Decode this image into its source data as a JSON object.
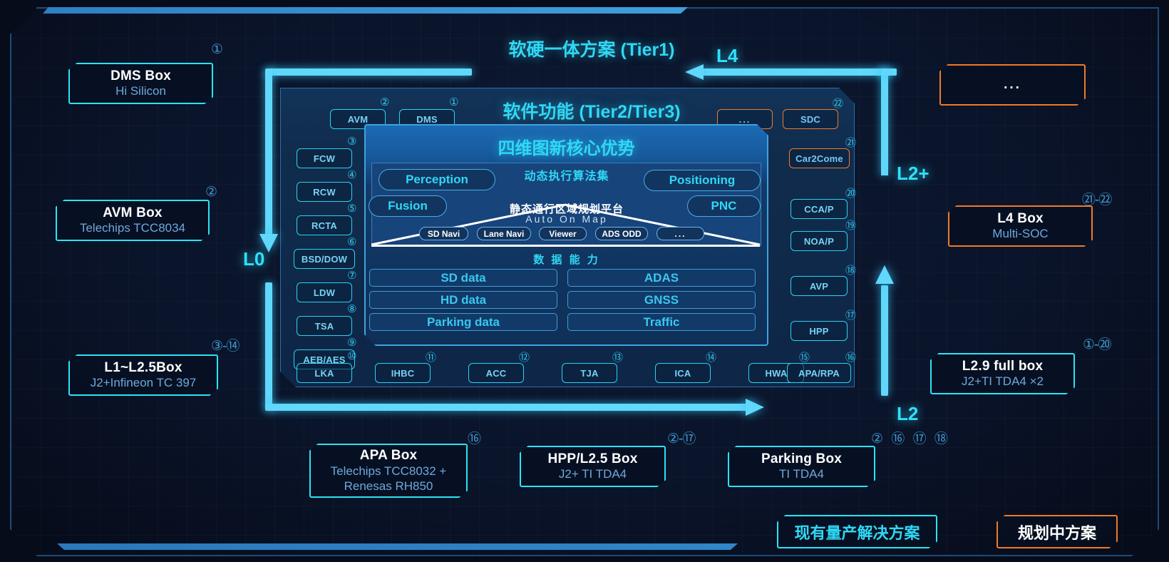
{
  "titles": {
    "tier1": "软硬一体方案 (Tier1)",
    "tier2": "软件功能 (Tier2/Tier3)",
    "core": "四维图新核心优势",
    "algo": "动态执行算法集",
    "pyramid_cn": "静态通行区域规划平台",
    "pyramid_en": "Auto On Map",
    "data_cn": "数 据 能 力"
  },
  "flow_labels": {
    "l0": "L0",
    "l2": "L2",
    "l2plus": "L2+",
    "l4": "L4"
  },
  "left_boxes": [
    {
      "title": "DMS Box",
      "sub": "Hi Silicon",
      "idx": "①"
    },
    {
      "title": "AVM Box",
      "sub": "Telechips TCC8034",
      "idx": "②"
    },
    {
      "title": "L1~L2.5Box",
      "sub": "J2+Infineon TC 397",
      "idx": "③-⑭"
    }
  ],
  "right_boxes": [
    {
      "title": "",
      "sub": "",
      "dots": "...",
      "idx": ""
    },
    {
      "title": "L4 Box",
      "sub": "Multi-SOC",
      "idx": "㉑-㉒"
    },
    {
      "title": "L2.9 full box",
      "sub": "J2+TI TDA4 ×2",
      "idx": "①-⑳"
    }
  ],
  "bottom_boxes": [
    {
      "title": "APA Box",
      "sub": "Telechips TCC8032 +",
      "sub2": "Renesas RH850",
      "idx": "⑯"
    },
    {
      "title": "HPP/L2.5 Box",
      "sub": "J2+ TI TDA4",
      "idx": "②-⑰"
    },
    {
      "title": "Parking Box",
      "sub": "TI TDA4",
      "idx": "② ⑯ ⑰ ⑱"
    }
  ],
  "top_tags": [
    {
      "label": "AVM",
      "idx": "②",
      "style": "cyan"
    },
    {
      "label": "DMS",
      "idx": "①",
      "style": "cyan"
    },
    {
      "label": "...",
      "idx": "",
      "style": "orange"
    },
    {
      "label": "SDC",
      "idx": "㉒",
      "style": "orange"
    }
  ],
  "left_tags": [
    {
      "label": "FCW",
      "idx": "③"
    },
    {
      "label": "RCW",
      "idx": "④"
    },
    {
      "label": "RCTA",
      "idx": "⑤"
    },
    {
      "label": "BSD/DOW",
      "idx": "⑥"
    },
    {
      "label": "LDW",
      "idx": "⑦"
    },
    {
      "label": "TSA",
      "idx": "⑧"
    },
    {
      "label": "AEB/AES",
      "idx": "⑨"
    }
  ],
  "right_tags": [
    {
      "label": "Car2Come",
      "idx": "㉑",
      "style": "orange"
    },
    {
      "label": "CCA/P",
      "idx": "⑳",
      "style": "cyan"
    },
    {
      "label": "NOA/P",
      "idx": "⑲",
      "style": "cyan"
    },
    {
      "label": "AVP",
      "idx": "⑱",
      "style": "cyan"
    },
    {
      "label": "HPP",
      "idx": "⑰",
      "style": "cyan"
    }
  ],
  "bottom_tags": [
    {
      "label": "LKA",
      "idx": "⑩"
    },
    {
      "label": "IHBC",
      "idx": "⑪"
    },
    {
      "label": "ACC",
      "idx": "⑫"
    },
    {
      "label": "TJA",
      "idx": "⑬"
    },
    {
      "label": "ICA",
      "idx": "⑭"
    },
    {
      "label": "HWA",
      "idx": "⑮"
    },
    {
      "label": "APA/RPA",
      "idx": "⑯"
    }
  ],
  "core_pills": [
    {
      "label": "Perception"
    },
    {
      "label": "Fusion"
    },
    {
      "label": "Positioning"
    },
    {
      "label": "PNC"
    }
  ],
  "map_tags": [
    "SD Navi",
    "Lane Navi",
    "Viewer",
    "ADS ODD",
    "..."
  ],
  "data_bars": {
    "left": [
      "SD data",
      "HD data",
      "Parking data"
    ],
    "right": [
      "ADAS",
      "GNSS",
      "Traffic"
    ]
  },
  "legend": [
    {
      "label": "现有量产解决方案",
      "style": "cyan"
    },
    {
      "label": "规划中方案",
      "style": "orange"
    }
  ],
  "colors": {
    "cyan": "#2ae4f5",
    "orange": "#ef7a2a",
    "panel_blue": "#1c6bb4"
  }
}
